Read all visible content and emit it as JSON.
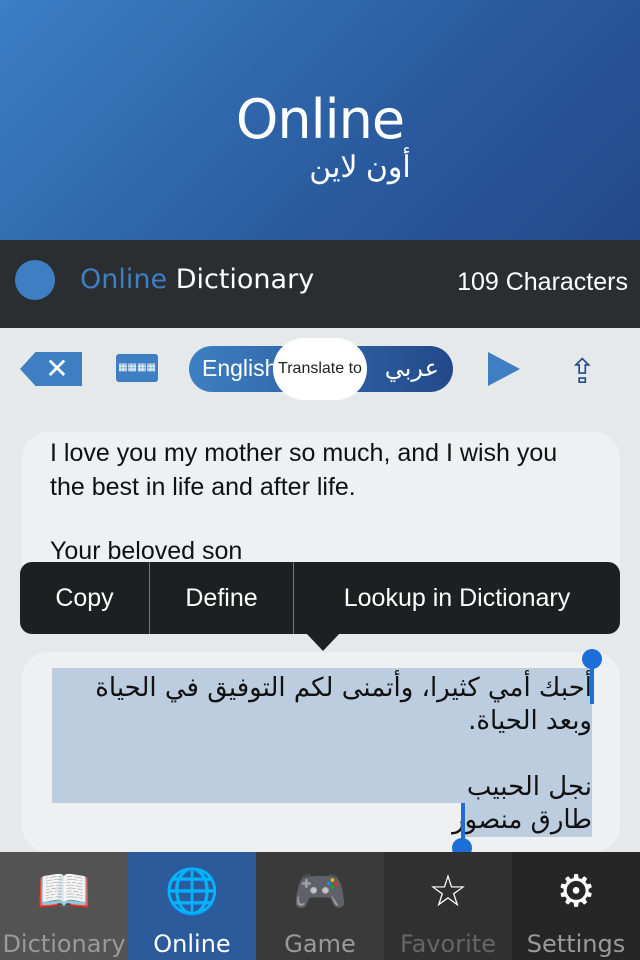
{
  "hero": {
    "title": "Online",
    "subtitle": "أون لاين"
  },
  "header": {
    "title_part1": "Online",
    "title_part2": "Dictionary",
    "char_count": "109 Characters",
    "icon": "globe-icon"
  },
  "toolbar": {
    "clear_icon": "backspace-x-icon",
    "keyboard_icon": "keyboard-icon",
    "source_lang": "English",
    "translate_label": "Translate to",
    "target_lang": "عربي",
    "play_icon": "play-icon",
    "share_icon": "share-icon"
  },
  "source_text": {
    "line1": "I love you my mother so much, and I wish you the best in life and after life.",
    "line2": "Your beloved son"
  },
  "context_menu": {
    "items": [
      "Copy",
      "Define",
      "Lookup in Dictionary"
    ]
  },
  "translation": {
    "text": "أحبك أمي كثيرا، وأتمنى لكم التوفيق في الحياة وبعد الحياة.\n\nنجل الحبيب\nطارق منصور"
  },
  "tabs": [
    {
      "label": "Dictionary",
      "icon": "book-icon",
      "bg": "#535353",
      "color": "#9a9a9a"
    },
    {
      "label": "Online",
      "icon": "globe-icon",
      "bg": "#2c5b9c",
      "color": "#ffffff",
      "active": true
    },
    {
      "label": "Game",
      "icon": "gamepad-icon",
      "bg": "#3a3a3a",
      "color": "#9a9a9a"
    },
    {
      "label": "Favorite",
      "icon": "star-icon",
      "bg": "#303030",
      "color": "#666666"
    },
    {
      "label": "Settings",
      "icon": "gear-icon",
      "bg": "#262626",
      "color": "#9a9a9a"
    }
  ],
  "colors": {
    "accent": "#3d7fc2",
    "selection": "#bccddf",
    "handle": "#1c6fd6"
  }
}
